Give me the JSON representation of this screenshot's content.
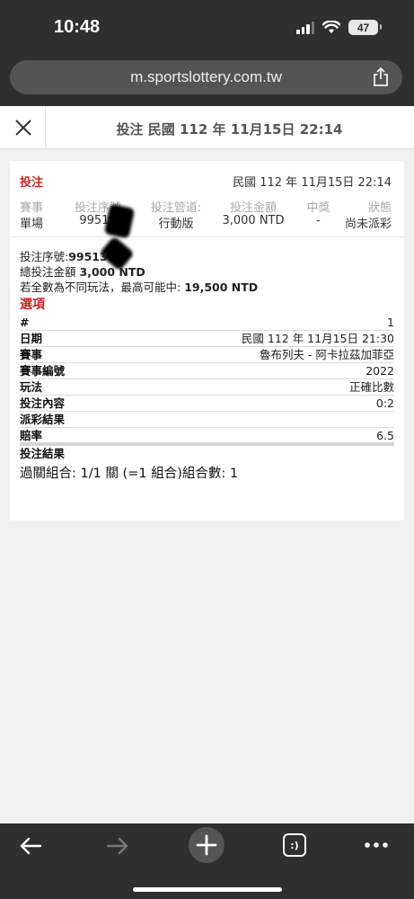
{
  "status_bar": {
    "time": "10:48",
    "battery": "47"
  },
  "browser": {
    "url": "m.sportslottery.com.tw"
  },
  "header": {
    "title": "投注 民國 112 年 11月15日 22:14"
  },
  "bet": {
    "title": "投注",
    "date": "民國 112 年 11月15日 22:14",
    "summary_headers": [
      "賽事",
      "投注序號",
      "投注管道:",
      "投注金額",
      "中獎",
      "狀態"
    ],
    "summary_values": [
      "單場",
      "99513",
      "行動版",
      "3,000 NTD",
      "-",
      "尚未派彩"
    ],
    "serial_label": "投注序號:",
    "serial_value": "99513",
    "total_label": "總投注金額",
    "total_value": "3,000 NTD",
    "max_label": "若全數為不同玩法，最高可能中:",
    "max_value": "19,500 NTD",
    "options_title": "選項",
    "rows": [
      {
        "key": "#",
        "value": "1"
      },
      {
        "key": "日期",
        "value": "民國 112 年 11月15日 21:30"
      },
      {
        "key": "賽事",
        "value": "魯布列夫 - 阿卡拉茲加菲亞"
      },
      {
        "key": "賽事編號",
        "value": "2022"
      },
      {
        "key": "玩法",
        "value": "正確比數"
      },
      {
        "key": "投注內容",
        "value": "0:2"
      },
      {
        "key": "派彩結果",
        "value": ""
      },
      {
        "key": "賠率",
        "value": "6.5"
      },
      {
        "key": "投注結果",
        "value": ""
      }
    ],
    "combo_text": "過關組合: 1/1 關 (=1 組合)組合數: 1"
  },
  "colors": {
    "accent_red": "#c62828",
    "chrome_dark": "#2f2f2f"
  },
  "icons": [
    "signal-icon",
    "wifi-icon",
    "battery-icon",
    "share-icon",
    "close-icon",
    "back-arrow-icon",
    "forward-arrow-icon",
    "plus-icon",
    "tabs-icon",
    "more-icon"
  ],
  "toolbar": {
    "tabs_label": ":)"
  }
}
